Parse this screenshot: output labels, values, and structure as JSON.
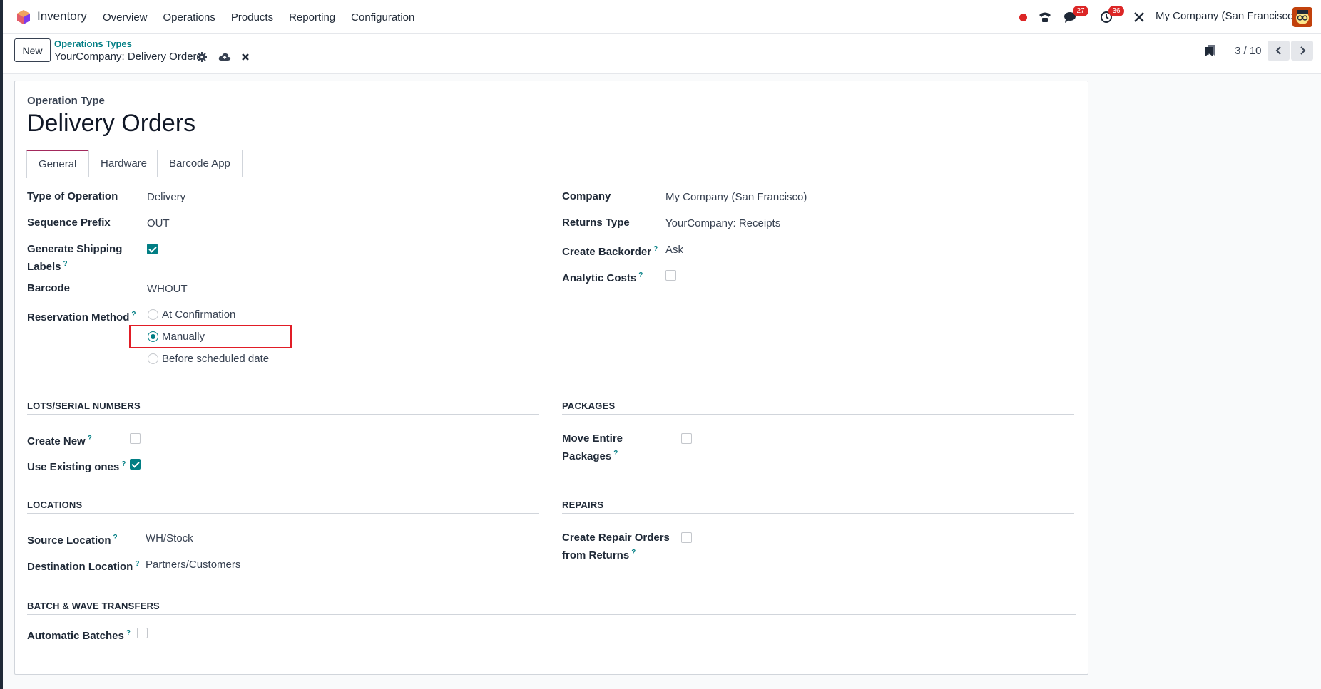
{
  "app": {
    "name": "Inventory"
  },
  "menu": [
    "Overview",
    "Operations",
    "Products",
    "Reporting",
    "Configuration"
  ],
  "systray": {
    "messages_count": "27",
    "activities_count": "36",
    "company": "My Company (San Francisco)"
  },
  "control": {
    "new_label": "New",
    "breadcrumb_parent": "Operations Types",
    "breadcrumb_current": "YourCompany: Delivery Orders",
    "pager": "3 / 10"
  },
  "form": {
    "type_label": "Operation Type",
    "title": "Delivery Orders",
    "tabs": [
      "General",
      "Hardware",
      "Barcode App"
    ],
    "left": {
      "type_of_operation": {
        "label": "Type of Operation",
        "value": "Delivery"
      },
      "sequence_prefix": {
        "label": "Sequence Prefix",
        "value": "OUT"
      },
      "generate_shipping": {
        "label_line1": "Generate Shipping",
        "label_line2": "Labels",
        "checked": true
      },
      "barcode": {
        "label": "Barcode",
        "value": "WHOUT"
      },
      "reservation": {
        "label": "Reservation Method",
        "options": [
          "At Confirmation",
          "Manually",
          "Before scheduled date"
        ],
        "selected": "Manually"
      }
    },
    "right": {
      "company": {
        "label": "Company",
        "value": "My Company (San Francisco)"
      },
      "returns_type": {
        "label": "Returns Type",
        "value": "YourCompany: Receipts"
      },
      "create_backorder": {
        "label": "Create Backorder",
        "value": "Ask"
      },
      "analytic_costs": {
        "label": "Analytic Costs",
        "checked": false
      }
    },
    "lots": {
      "title": "LOTS/SERIAL NUMBERS",
      "create_new": {
        "label": "Create New",
        "checked": false
      },
      "use_existing": {
        "label": "Use Existing ones",
        "checked": true
      }
    },
    "packages": {
      "title": "PACKAGES",
      "move_entire": {
        "label_line1": "Move Entire",
        "label_line2": "Packages",
        "checked": false
      }
    },
    "locations": {
      "title": "LOCATIONS",
      "source": {
        "label": "Source Location",
        "value": "WH/Stock"
      },
      "destination": {
        "label": "Destination Location",
        "value": "Partners/Customers"
      }
    },
    "repairs": {
      "title": "REPAIRS",
      "create_repair": {
        "label_line1": "Create Repair Orders",
        "label_line2": "from Returns",
        "checked": false
      }
    },
    "batch": {
      "title": "BATCH & WAVE TRANSFERS",
      "automatic": {
        "label": "Automatic Batches",
        "checked": false
      }
    },
    "help_mark": "?"
  },
  "colors": {
    "accent": "#017e84",
    "brand": "#a3295c",
    "highlight": "#e11d26"
  }
}
